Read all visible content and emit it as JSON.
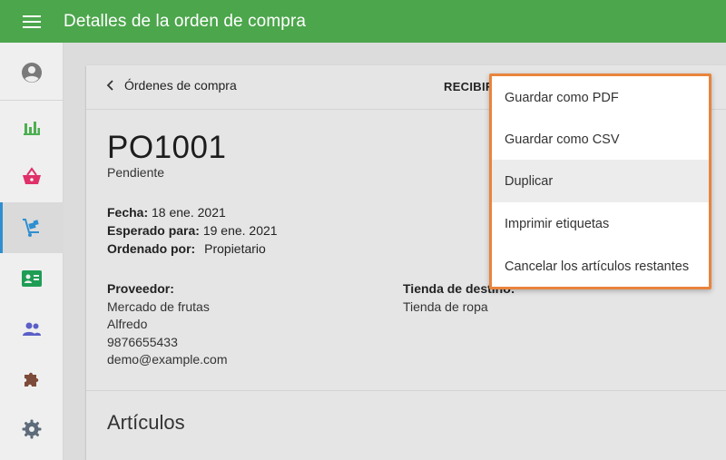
{
  "header": {
    "title": "Detalles de la orden de compra",
    "menu_icon": "hamburger-menu-icon",
    "color": "#4ca64c"
  },
  "sidebar": {
    "items": [
      {
        "name": "profile",
        "icon": "user-circle-icon",
        "color": "#7a7a7a"
      },
      {
        "name": "reports",
        "icon": "bar-chart-icon",
        "color": "#4caf50"
      },
      {
        "name": "sales",
        "icon": "basket-icon",
        "color": "#e0306a"
      },
      {
        "name": "inventory",
        "icon": "hand-truck-icon",
        "color": "#2e8fd0",
        "active": true
      },
      {
        "name": "customers",
        "icon": "contact-card-icon",
        "color": "#1f9d55"
      },
      {
        "name": "employees",
        "icon": "people-icon",
        "color": "#5b5fc7"
      },
      {
        "name": "integrations",
        "icon": "puzzle-icon",
        "color": "#7d4b3a"
      },
      {
        "name": "settings",
        "icon": "gear-icon",
        "color": "#5d6b7a"
      }
    ],
    "active_color": "#2e8fd0"
  },
  "card": {
    "back_label": "Órdenes de compra",
    "receive_label": "RECIBIR",
    "po_number": "PO1001",
    "status": "Pendiente",
    "date_label": "Fecha:",
    "date_value": "18 ene. 2021",
    "expected_label": "Esperado para:",
    "expected_value": "19 ene. 2021",
    "ordered_by_label": "Ordenado por:",
    "ordered_by_value": "Propietario",
    "supplier_label": "Proveedor:",
    "supplier_name": "Mercado de frutas",
    "supplier_contact": "Alfredo",
    "supplier_phone": "9876655433",
    "supplier_email": "demo@example.com",
    "store_label": "Tienda de destino:",
    "store_value": "Tienda de ropa",
    "items_title": "Artículos"
  },
  "dropdown": {
    "border_color": "#e8843c",
    "items": [
      {
        "label": "Guardar como PDF"
      },
      {
        "label": "Guardar como CSV"
      },
      {
        "label": "Duplicar",
        "highlighted": true
      },
      {
        "label": "Imprimir etiquetas"
      },
      {
        "label": "Cancelar los artículos restantes"
      }
    ]
  }
}
